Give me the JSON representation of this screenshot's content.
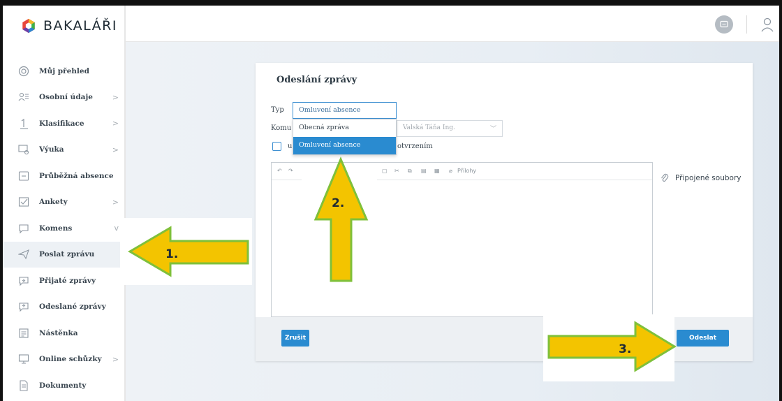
{
  "app": {
    "logo_text": "BAKALÁŘI"
  },
  "sidebar": {
    "items": [
      {
        "label": "Můj přehled",
        "icon": "dashboard-icon",
        "chevron": ""
      },
      {
        "label": "Osobní údaje",
        "icon": "personal-data-icon",
        "chevron": ">"
      },
      {
        "label": "Klasifikace",
        "icon": "grade-icon",
        "chevron": ">"
      },
      {
        "label": "Výuka",
        "icon": "teaching-icon",
        "chevron": ">"
      },
      {
        "label": "Průběžná absence",
        "icon": "absence-icon",
        "chevron": ""
      },
      {
        "label": "Ankety",
        "icon": "survey-icon",
        "chevron": ">"
      },
      {
        "label": "Komens",
        "icon": "komens-icon",
        "chevron": "v"
      },
      {
        "label": "Poslat zprávu",
        "icon": "send-message-icon",
        "chevron": ""
      },
      {
        "label": "Přijaté zprávy",
        "icon": "inbox-icon",
        "chevron": ""
      },
      {
        "label": "Odeslané zprávy",
        "icon": "sent-icon",
        "chevron": ""
      },
      {
        "label": "Nástěnka",
        "icon": "noticeboard-icon",
        "chevron": ""
      },
      {
        "label": "Online schůzky",
        "icon": "online-meeting-icon",
        "chevron": ">"
      },
      {
        "label": "Dokumenty",
        "icon": "documents-icon",
        "chevron": ""
      }
    ]
  },
  "form": {
    "title": "Odeslání zprávy",
    "typ_label": "Typ",
    "typ_value": "Omluvení absence",
    "dropdown_options": [
      "Obecná zpráva",
      "Omluvení absence"
    ],
    "komu_label": "Komu",
    "komu_value": "Valská Táňa Ing.",
    "checkbox_label_start": "u",
    "checkbox_label_end": "otvrzením",
    "toolbar_attachments": "Přílohy",
    "attached_files_label": "Připojené soubory",
    "cancel_label": "Zrušit",
    "send_label": "Odeslat"
  },
  "annotations": {
    "arrow1": "1.",
    "arrow2": "2.",
    "arrow3": "3."
  },
  "colors": {
    "accent": "#2a8bd0",
    "arrow_fill": "#f3c400",
    "arrow_stroke": "#7fc03a"
  }
}
